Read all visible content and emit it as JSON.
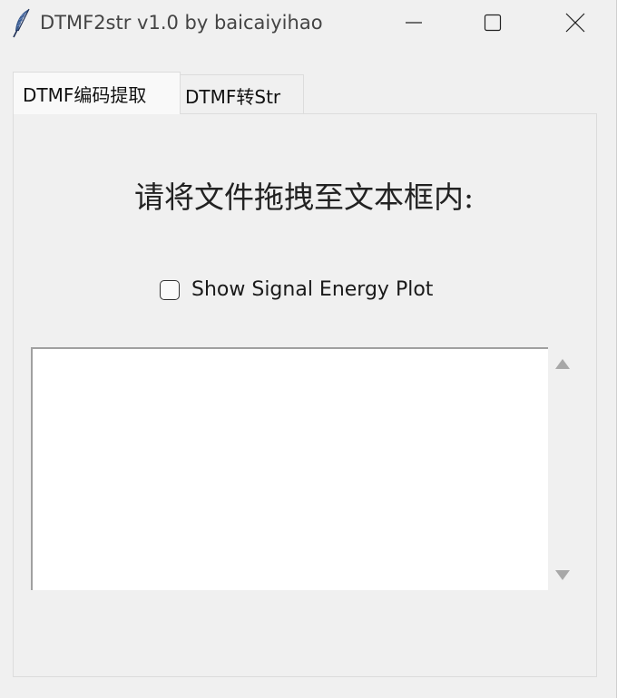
{
  "window": {
    "title": "DTMF2str v1.0 by baicaiyihao",
    "icon": "feather-icon",
    "controls": [
      "minimize-icon",
      "maximize-icon",
      "close-icon"
    ]
  },
  "tabs": [
    {
      "label": "DTMF编码提取",
      "active": true
    },
    {
      "label": "DTMF转Str",
      "active": false
    }
  ],
  "main": {
    "instruction": "请将文件拖拽至文本框内:",
    "checkbox": {
      "label": "Show Signal Energy Plot",
      "checked": false
    },
    "textarea": {
      "value": ""
    }
  }
}
